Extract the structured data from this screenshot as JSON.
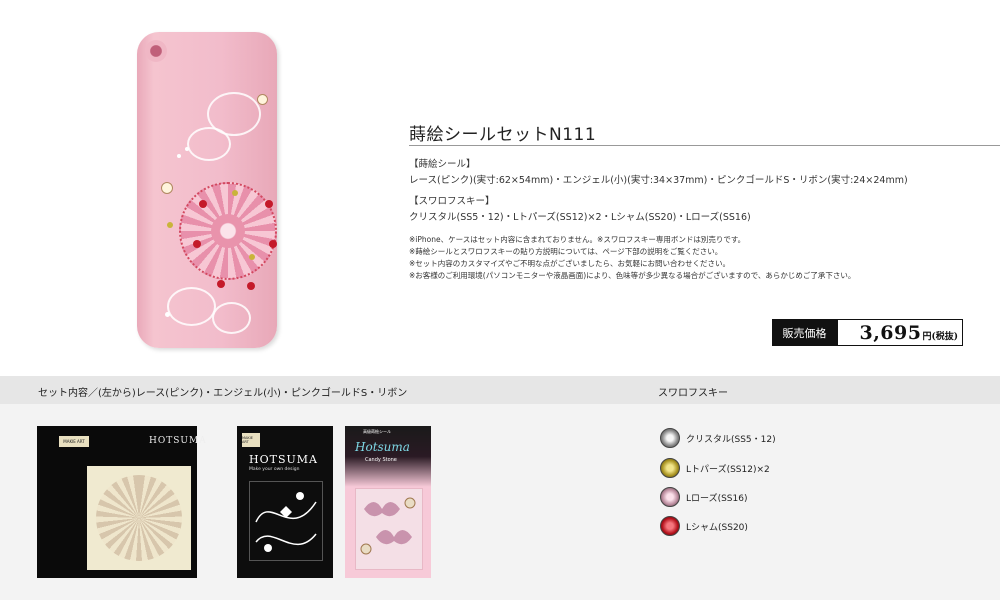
{
  "product": {
    "title": "蒔絵シールセットN111",
    "sticker_heading": "【蒔絵シール】",
    "sticker_detail": "レース(ピンク)(実寸:62×54mm)・エンジェル(小)(実寸:34×37mm)・ピンクゴールドS・リボン(実寸:24×24mm)",
    "swarovski_heading": "【スワロフスキー】",
    "swarovski_detail": "クリスタル(SS5・12)・Lトパーズ(SS12)×2・Lシャム(SS20)・Lローズ(SS16)",
    "notes": [
      "※iPhone、ケースはセット内容に含まれておりません。※スワロフスキー専用ボンドは別売りです。",
      "※蒔絵シールとスワロフスキーの貼り方説明については、ページ下部の説明をご覧ください。",
      "※セット内容のカスタマイズやご不明な点がございましたら、お気軽にお問い合わせください。",
      "※お客様のご利用環境(パソコンモニターや液晶画面)により、色味等が多少異なる場合がございますので、あらかじめご了承下さい。"
    ]
  },
  "price": {
    "label": "販売価格",
    "amount": "3,695",
    "unit": "円(税抜)"
  },
  "contents_band": {
    "left_label": "セット内容／(左から)レース(ピンク)・エンジェル(小)・ピンクゴールドS・リボン",
    "right_label": "スワロフスキー"
  },
  "packs": {
    "pack1": {
      "tag": "MAKIE ART",
      "brand": "HOTSUMA"
    },
    "pack2": {
      "tag": "MAKIE ART",
      "brand": "HOTSUMA",
      "sub": "Make your own design"
    },
    "pack3": {
      "header": "高級蒔絵シール",
      "brand": "Hotsuma",
      "sub": "Candy Stone"
    }
  },
  "swarovski_legend": [
    {
      "label": "クリスタル(SS5・12)",
      "color": "#b8b8b8",
      "icon": "crystal-gem-icon"
    },
    {
      "label": "Lトパーズ(SS12)×2",
      "color": "#c9b43a",
      "icon": "light-topaz-gem-icon"
    },
    {
      "label": "Lローズ(SS16)",
      "color": "#e8b4c4",
      "icon": "light-rose-gem-icon"
    },
    {
      "label": "Lシャム(SS20)",
      "color": "#d2232f",
      "icon": "light-siam-gem-icon"
    }
  ]
}
